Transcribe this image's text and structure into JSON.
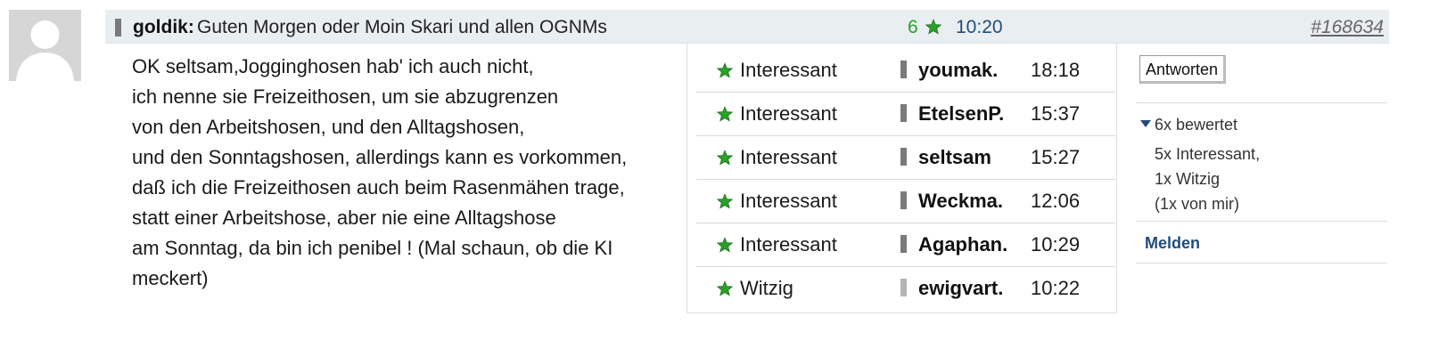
{
  "post": {
    "author": "goldik:",
    "title": "Guten Morgen oder Moin Skari und allen OGNMs",
    "score": "6",
    "time": "10:20",
    "id": "#168634",
    "body_lines": [
      "OK seltsam,Jogginghosen hab' ich auch nicht,",
      "ich nenne sie Freizeithosen, um sie abzugrenzen",
      "von den Arbeitshosen, und den Alltagshosen,",
      "und den Sonntagshosen, allerdings kann es vorkommen,",
      "daß ich die Freizeithosen auch beim Rasenmähen trage,",
      "statt einer Arbeitshose, aber nie eine Alltagshose",
      "am Sonntag, da bin ich penibel ! (Mal schaun, ob die KI",
      "meckert)"
    ]
  },
  "ratings": [
    {
      "type": "Interessant",
      "user": "youmak.",
      "time": "18:18",
      "bar": "dark"
    },
    {
      "type": "Interessant",
      "user": "EtelsenP.",
      "time": "15:37",
      "bar": "dark"
    },
    {
      "type": "Interessant",
      "user": "seltsam",
      "time": "15:27",
      "bar": "dark"
    },
    {
      "type": "Interessant",
      "user": "Weckma.",
      "time": "12:06",
      "bar": "dark"
    },
    {
      "type": "Interessant",
      "user": "Agaphan.",
      "time": "10:29",
      "bar": "dark"
    },
    {
      "type": "Witzig",
      "user": "ewigvart.",
      "time": "10:22",
      "bar": "light"
    }
  ],
  "side": {
    "reply_label": "Antworten",
    "summary_toggle": "6x bewertet",
    "summary_lines": [
      "5x Interessant,",
      "1x Witzig",
      "(1x von mir)"
    ],
    "report_label": "Melden"
  },
  "colors": {
    "header_bg": "#e9eef1",
    "score_green": "#2aa02a",
    "link_blue": "#1f4e79",
    "status_bar_dark": "#7a7a7a",
    "status_bar_light": "#b5b5b5"
  },
  "icons": {
    "avatar": "default-user-avatar-icon",
    "rating": "green-star-icon",
    "summary": "caret-down-icon"
  }
}
